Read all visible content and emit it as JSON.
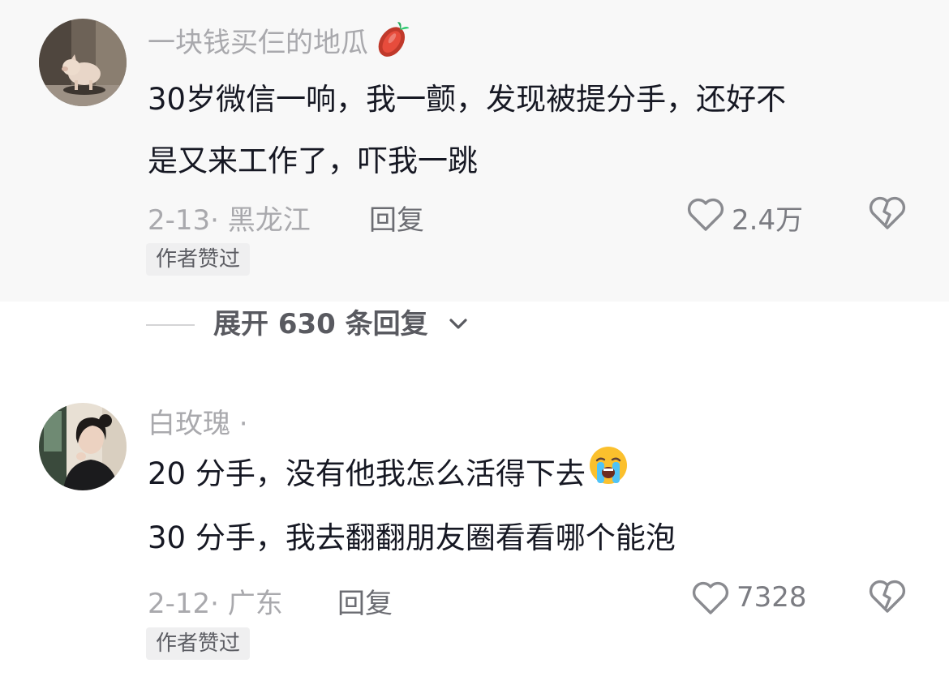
{
  "comments": [
    {
      "username": "一块钱买仨的地瓜",
      "username_emoji": "sweet-potato-icon",
      "lines": [
        "30岁微信一响，我一颤，发现被提分手，还好不",
        "是又来工作了，吓我一跳"
      ],
      "date_location": "2-13· 黑龙江",
      "reply_label": "回复",
      "like_count": "2.4万",
      "badge": "作者赞过"
    },
    {
      "username": "白玫瑰 ·",
      "lines": [
        "20 分手，没有他我怎么活得下去",
        "30 分手，我去翻翻朋友圈看看哪个能泡"
      ],
      "line1_emoji": "crying-face-icon",
      "date_location": "2-12· 广东",
      "reply_label": "回复",
      "like_count": "7328",
      "badge": "作者赞过"
    }
  ],
  "expand_replies": {
    "label": "展开 630 条回复"
  },
  "colors": {
    "primary_text": "#161823",
    "secondary_text": "#a9a9ad",
    "highlight_bg": "#f8f8f8",
    "badge_bg": "#efeff0"
  }
}
